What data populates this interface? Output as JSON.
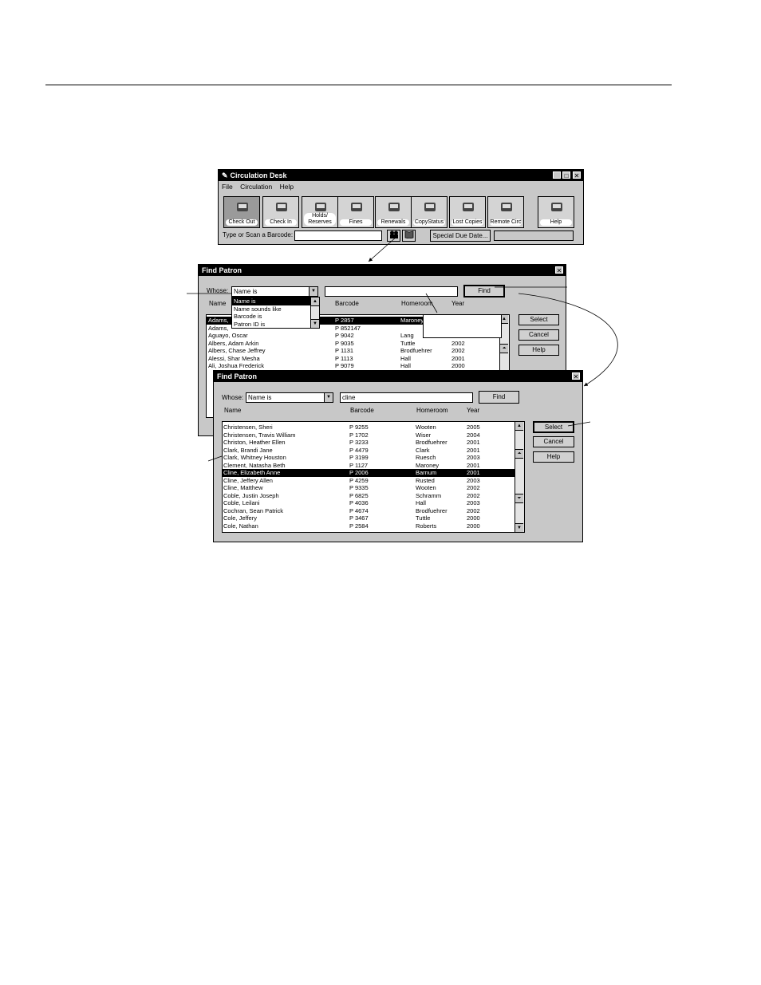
{
  "circulation_window": {
    "title": "Circulation Desk",
    "menu": [
      "File",
      "Circulation",
      "Help"
    ],
    "toolbar": [
      {
        "label": "Check Out",
        "icon": "check-out-icon",
        "pressed": true
      },
      {
        "label": "Check In",
        "icon": "check-in-icon",
        "pressed": false
      },
      {
        "label": "Holds/ Reserves",
        "icon": "holds-icon",
        "pressed": false
      },
      {
        "label": "Fines",
        "icon": "fines-icon",
        "pressed": false
      },
      {
        "label": "Renewals",
        "icon": "renewals-icon",
        "pressed": false
      },
      {
        "label": "CopyStatus",
        "icon": "copy-status-icon",
        "pressed": false
      },
      {
        "label": "Lost Copies",
        "icon": "lost-copies-icon",
        "pressed": false
      },
      {
        "label": "Remote Circ",
        "icon": "remote-circ-icon",
        "pressed": false
      },
      {
        "label": "Help",
        "icon": "help-icon",
        "pressed": false
      }
    ],
    "scan_label": "Type or Scan a Barcode:",
    "scan_value": "",
    "special_due_date_label": "Special Due Date..."
  },
  "find_patron_back": {
    "title": "Find Patron",
    "whose_label": "Whose:",
    "whose_value": "Name is",
    "search_value": "",
    "find_label": "Find",
    "columns": [
      "Name",
      "Barcode",
      "Homeroom",
      "Year"
    ],
    "dropdown_options": [
      "Name is",
      "Name sounds like",
      "Barcode is",
      "Patron ID is"
    ],
    "rows": [
      {
        "name": "Adams,",
        "barcode": "P 2857",
        "homeroom": "Maroney",
        "year": ""
      },
      {
        "name": "Adams,",
        "barcode": "P 852147",
        "homeroom": "",
        "year": ""
      },
      {
        "name": "Aguayo, Oscar",
        "barcode": "P 9042",
        "homeroom": "Lang",
        "year": ""
      },
      {
        "name": "Albers, Adam Arkin",
        "barcode": "P 9035",
        "homeroom": "Tuttle",
        "year": "2002"
      },
      {
        "name": "Albers, Chase Jeffrey",
        "barcode": "P 1131",
        "homeroom": "Brodfuehrer",
        "year": "2002"
      },
      {
        "name": "Alessi, Shar Mesha",
        "barcode": "P 1113",
        "homeroom": "Hall",
        "year": "2001"
      },
      {
        "name": "Ali, Joshua Frederick",
        "barcode": "P 9079",
        "homeroom": "Hall",
        "year": "2000"
      }
    ],
    "buttons": [
      "Select",
      "Cancel",
      "Help"
    ]
  },
  "find_patron_front": {
    "title": "Find Patron",
    "whose_label": "Whose:",
    "whose_value": "Name is",
    "search_value": "cline",
    "find_label": "Find",
    "columns": [
      "Name",
      "Barcode",
      "Homeroom",
      "Year"
    ],
    "rows": [
      {
        "name": "Christensen, Sheri",
        "barcode": "P 9255",
        "homeroom": "Wooten",
        "year": "2005"
      },
      {
        "name": "Christensen, Travis William",
        "barcode": "P 1702",
        "homeroom": "Wiser",
        "year": "2004"
      },
      {
        "name": "Christon, Heather Ellen",
        "barcode": "P 3233",
        "homeroom": "Brodfuehrer",
        "year": "2001"
      },
      {
        "name": "Clark, Brandi Jane",
        "barcode": "P 4479",
        "homeroom": "Clark",
        "year": "2001"
      },
      {
        "name": "Clark, Whitney Houston",
        "barcode": "P 3199",
        "homeroom": "Ruesch",
        "year": "2003"
      },
      {
        "name": "Clement, Natasha Beth",
        "barcode": "P 1127",
        "homeroom": "Maroney",
        "year": "2001"
      },
      {
        "name": "Cline, Elizabeth Anne",
        "barcode": "P 2006",
        "homeroom": "Barnum",
        "year": "2001"
      },
      {
        "name": "Cline, Jeffery Allen",
        "barcode": "P 4259",
        "homeroom": "Rusted",
        "year": "2003"
      },
      {
        "name": "Cline, Matthew",
        "barcode": "P 9335",
        "homeroom": "Wooten",
        "year": "2002"
      },
      {
        "name": "Coble, Justin Joseph",
        "barcode": "P 6825",
        "homeroom": "Schramm",
        "year": "2002"
      },
      {
        "name": "Coble, Leilani",
        "barcode": "P 4036",
        "homeroom": "Hall",
        "year": "2003"
      },
      {
        "name": "Cochran, Sean Patrick",
        "barcode": "P 4674",
        "homeroom": "Brodfuehrer",
        "year": "2002"
      },
      {
        "name": "Cole, Jeffery",
        "barcode": "P 3467",
        "homeroom": "Tuttle",
        "year": "2000"
      },
      {
        "name": "Cole, Nathan",
        "barcode": "P 2584",
        "homeroom": "Roberts",
        "year": "2000"
      }
    ],
    "selected_index": 6,
    "buttons": [
      "Select",
      "Cancel",
      "Help"
    ]
  }
}
